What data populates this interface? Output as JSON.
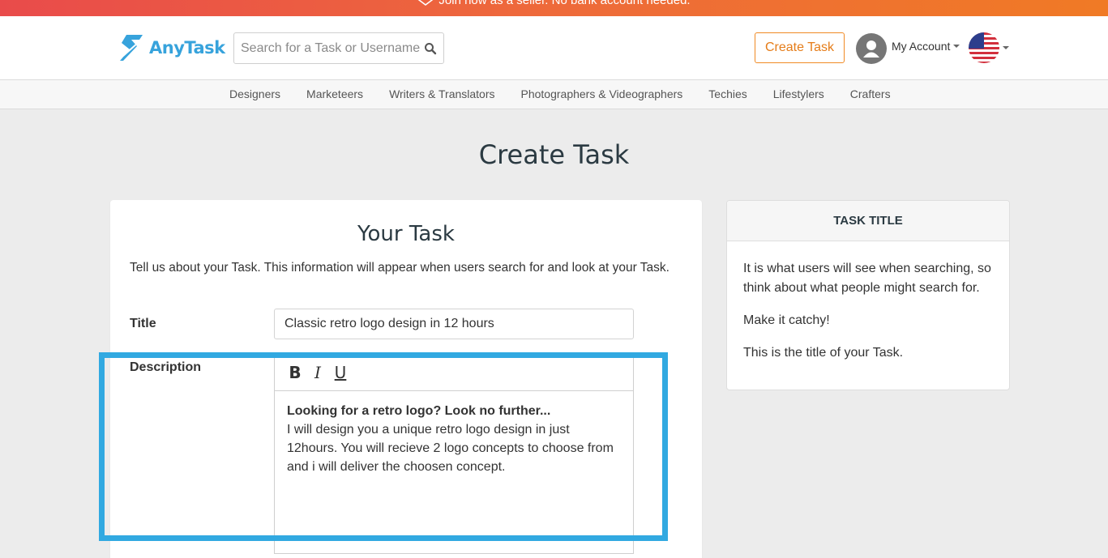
{
  "banner": {
    "text": "Join now as a seller. No bank account needed."
  },
  "header": {
    "logo_text": "AnyTask",
    "search_placeholder": "Search for a Task or Username",
    "create_task_label": "Create Task",
    "account_label": "My Account"
  },
  "categories": [
    "Designers",
    "Marketeers",
    "Writers & Translators",
    "Photographers & Videographers",
    "Techies",
    "Lifestylers",
    "Crafters"
  ],
  "page": {
    "title": "Create Task"
  },
  "form": {
    "heading": "Your Task",
    "intro": "Tell us about your Task. This information will appear when users search for and look at your Task.",
    "title_label": "Title",
    "title_value": "Classic retro logo design in 12 hours",
    "description_label": "Description",
    "toolbar": {
      "bold": "B",
      "italic": "I",
      "underline": "U"
    },
    "description_bold": "Looking for a retro logo? Look no further...",
    "description_text": "I will design you a unique retro logo design in just 12hours. You will recieve 2 logo concepts to choose from and i will deliver the choosen concept."
  },
  "tip": {
    "heading": "TASK TITLE",
    "lines": [
      "It is what users will see when searching, so think about what people might search for.",
      "Make it catchy!",
      "This is the title of your Task."
    ]
  },
  "colors": {
    "accent_orange": "#f08a24",
    "brand_blue": "#37a3dc",
    "highlight_blue": "#31a9e1"
  }
}
